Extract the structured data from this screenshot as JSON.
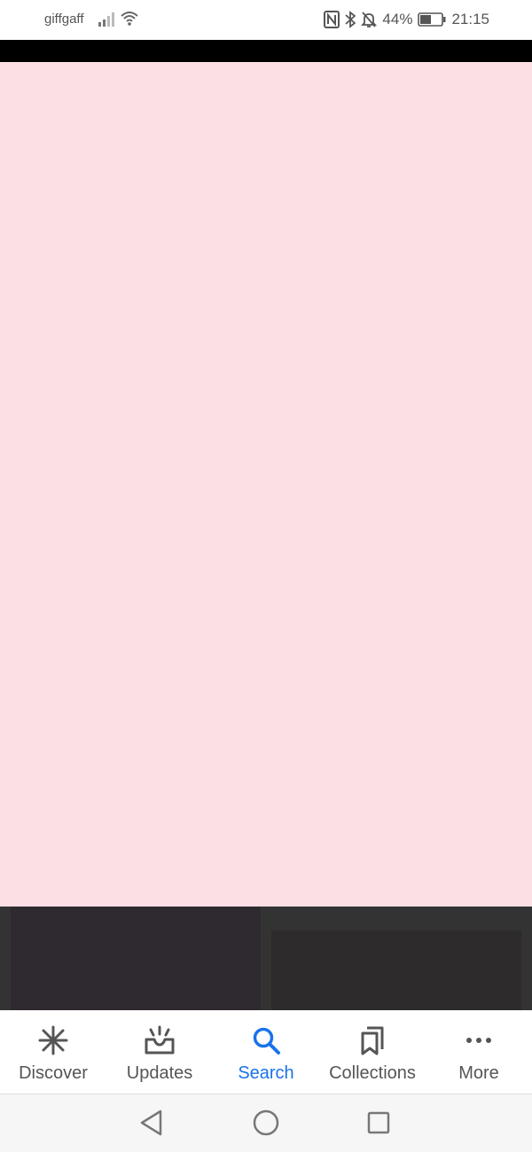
{
  "status_bar": {
    "carrier": "giffgaff",
    "battery_percent": "44%",
    "time": "21:15",
    "icons": [
      "signal-icon",
      "wifi-icon",
      "nfc-icon",
      "bluetooth-icon",
      "silent-bell-icon",
      "battery-icon"
    ]
  },
  "colors": {
    "content_background": "#fbdfe4",
    "dark_band": "#333333",
    "accent": "#1a73e8",
    "nav_inactive": "#555555"
  },
  "bottom_nav": {
    "items": [
      {
        "label": "Discover",
        "icon": "asterisk-icon",
        "active": false
      },
      {
        "label": "Updates",
        "icon": "updates-tray-icon",
        "active": false
      },
      {
        "label": "Search",
        "icon": "search-icon",
        "active": true
      },
      {
        "label": "Collections",
        "icon": "bookmarks-icon",
        "active": false
      },
      {
        "label": "More",
        "icon": "more-dots-icon",
        "active": false
      }
    ]
  },
  "system_nav": {
    "buttons": [
      "back-triangle-icon",
      "home-circle-icon",
      "recents-square-icon"
    ]
  }
}
